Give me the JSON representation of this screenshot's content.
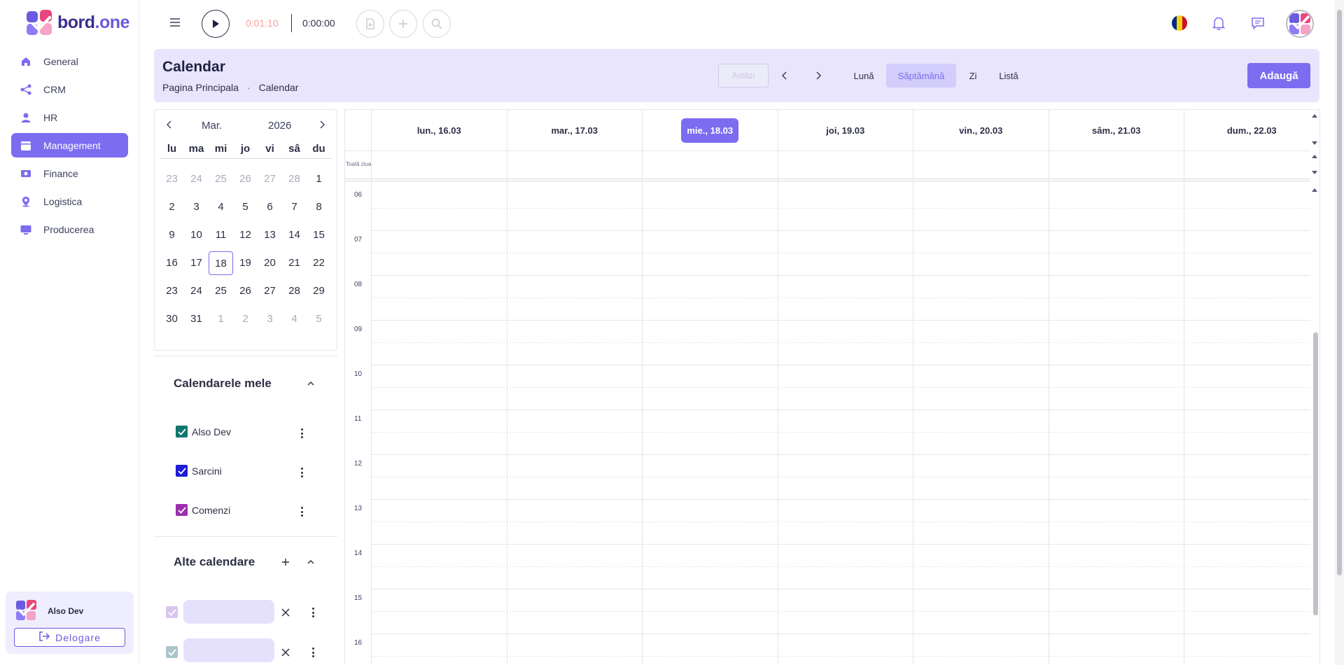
{
  "app": {
    "brand_prefix": "bord",
    "brand_suffix": ".one"
  },
  "sidebar": {
    "items": [
      {
        "label": "General",
        "icon": "home-icon"
      },
      {
        "label": "CRM",
        "icon": "share-icon"
      },
      {
        "label": "HR",
        "icon": "person-icon"
      },
      {
        "label": "Management",
        "icon": "calendar-icon",
        "active": true
      },
      {
        "label": "Finance",
        "icon": "money-icon"
      },
      {
        "label": "Logistica",
        "icon": "location-icon"
      },
      {
        "label": "Producerea",
        "icon": "monitor-icon"
      }
    ],
    "user_name": "Also Dev",
    "logout_label": "Delogare"
  },
  "topbar": {
    "timer_running": "0:01:10",
    "timer_total": "0:00:00"
  },
  "header": {
    "title": "Calendar",
    "breadcrumb": [
      "Pagina Principala",
      "·",
      "Calendar"
    ],
    "today_label": "Astăzi",
    "views": [
      "Lună",
      "Săptămână",
      "Zi",
      "Listă"
    ],
    "active_view": "Săptămână",
    "add_label": "Adaugă"
  },
  "mini_calendar": {
    "month": "Mar.",
    "year": "2026",
    "weekdays": [
      "lu",
      "ma",
      "mi",
      "jo",
      "vi",
      "sâ",
      "du"
    ],
    "weeks": [
      [
        "23",
        "24",
        "25",
        "26",
        "27",
        "28",
        "1"
      ],
      [
        "2",
        "3",
        "4",
        "5",
        "6",
        "7",
        "8"
      ],
      [
        "9",
        "10",
        "11",
        "12",
        "13",
        "14",
        "15"
      ],
      [
        "16",
        "17",
        "18",
        "19",
        "20",
        "21",
        "22"
      ],
      [
        "23",
        "24",
        "25",
        "26",
        "27",
        "28",
        "29"
      ],
      [
        "30",
        "31",
        "1",
        "2",
        "3",
        "4",
        "5"
      ]
    ],
    "selected": "18"
  },
  "my_calendars": {
    "title": "Calendarele mele",
    "items": [
      {
        "label": "Also Dev",
        "color": "#0f766e"
      },
      {
        "label": "Sarcini",
        "color": "#1d1dd6"
      },
      {
        "label": "Comenzi",
        "color": "#9b2fae"
      }
    ]
  },
  "other_calendars": {
    "title": "Alte calendare"
  },
  "week": {
    "allday_label": "Toată ziua",
    "days": [
      "lun., 16.03",
      "mar., 17.03",
      "mie., 18.03",
      "joi, 19.03",
      "vin., 20.03",
      "sâm., 21.03",
      "dum., 22.03"
    ],
    "today_index": 2,
    "hours": [
      "06",
      "07",
      "08",
      "09",
      "10",
      "11",
      "12",
      "13",
      "14",
      "15",
      "16"
    ]
  },
  "colors": {
    "accent": "#7c6cf0",
    "header_bg": "#e8e5fd"
  }
}
